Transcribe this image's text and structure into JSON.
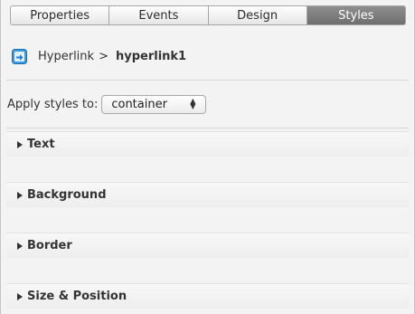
{
  "tabs": [
    {
      "label": "Properties",
      "active": false
    },
    {
      "label": "Events",
      "active": false
    },
    {
      "label": "Design",
      "active": false
    },
    {
      "label": "Styles",
      "active": true
    }
  ],
  "breadcrumb": {
    "icon": "hyperlink-icon",
    "parent": "Hyperlink",
    "separator": ">",
    "current": "hyperlink1"
  },
  "apply": {
    "label": "Apply styles to:",
    "selected": "container"
  },
  "sections": [
    {
      "label": "Text"
    },
    {
      "label": "Background"
    },
    {
      "label": "Border"
    },
    {
      "label": "Size & Position"
    }
  ],
  "colors": {
    "active_tab": "#7a7a7a",
    "panel_bg": "#f3f3f3",
    "icon_blue": "#2b8fd6"
  }
}
